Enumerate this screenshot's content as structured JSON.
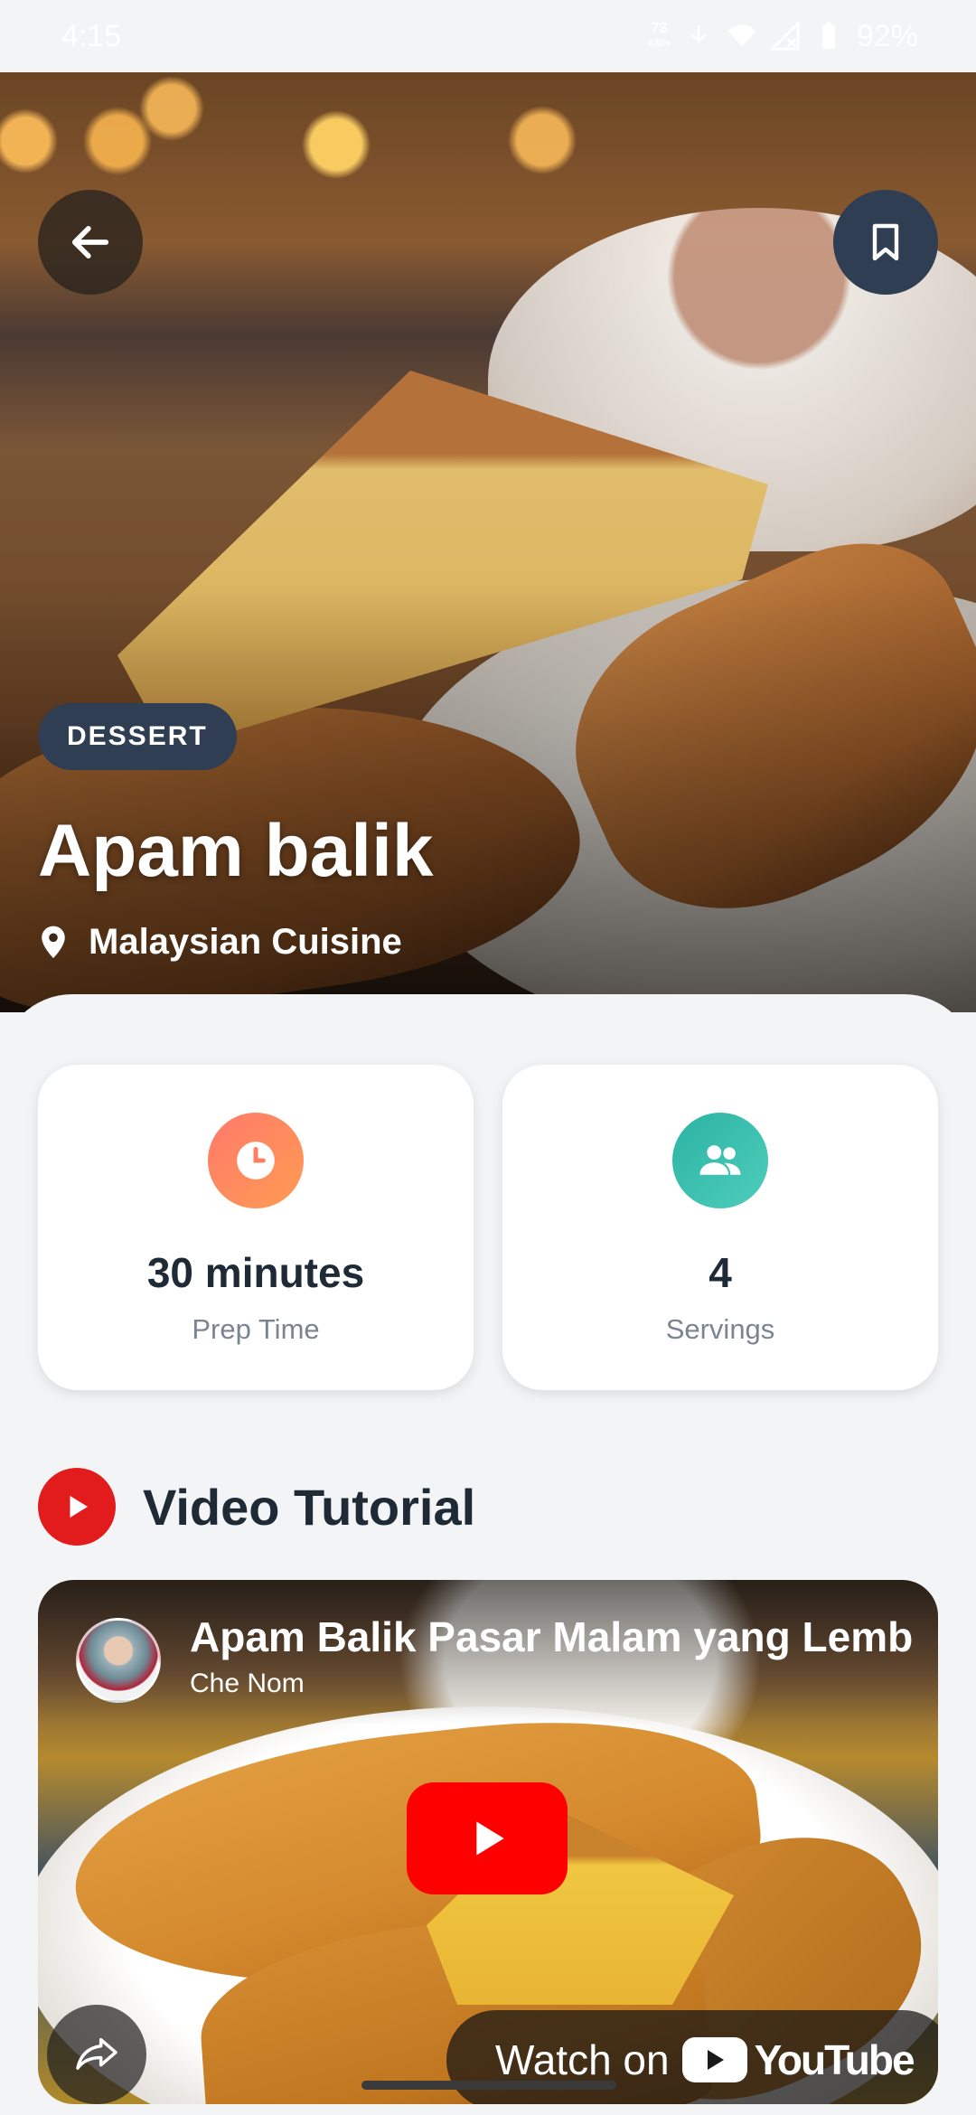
{
  "status_bar": {
    "time": "4:15",
    "net_speed_value": "73",
    "net_speed_unit": "KB/s",
    "battery": "92%"
  },
  "header": {
    "category": "DESSERT",
    "title": "Apam balik",
    "cuisine": "Malaysian Cuisine"
  },
  "stats": {
    "prep_value": "30 minutes",
    "prep_label": "Prep Time",
    "servings_value": "4",
    "servings_label": "Servings"
  },
  "video_section": {
    "heading": "Video Tutorial",
    "video_title": "Apam Balik Pasar Malam yang Lembut",
    "channel": "Che Nom",
    "watch_on": "Watch on",
    "youtube_word": "YouTube"
  },
  "colors": {
    "accent_dark": "#2f3e52",
    "prep_icon": "#ff8a5e",
    "servings_icon": "#3cc0b0",
    "youtube_red": "#ff0000"
  },
  "icons": {
    "back": "arrow-left-icon",
    "bookmark": "bookmark-icon",
    "location": "location-pin-icon",
    "prep": "clock-icon",
    "servings": "people-icon",
    "section": "youtube-play-icon",
    "share": "share-icon"
  }
}
